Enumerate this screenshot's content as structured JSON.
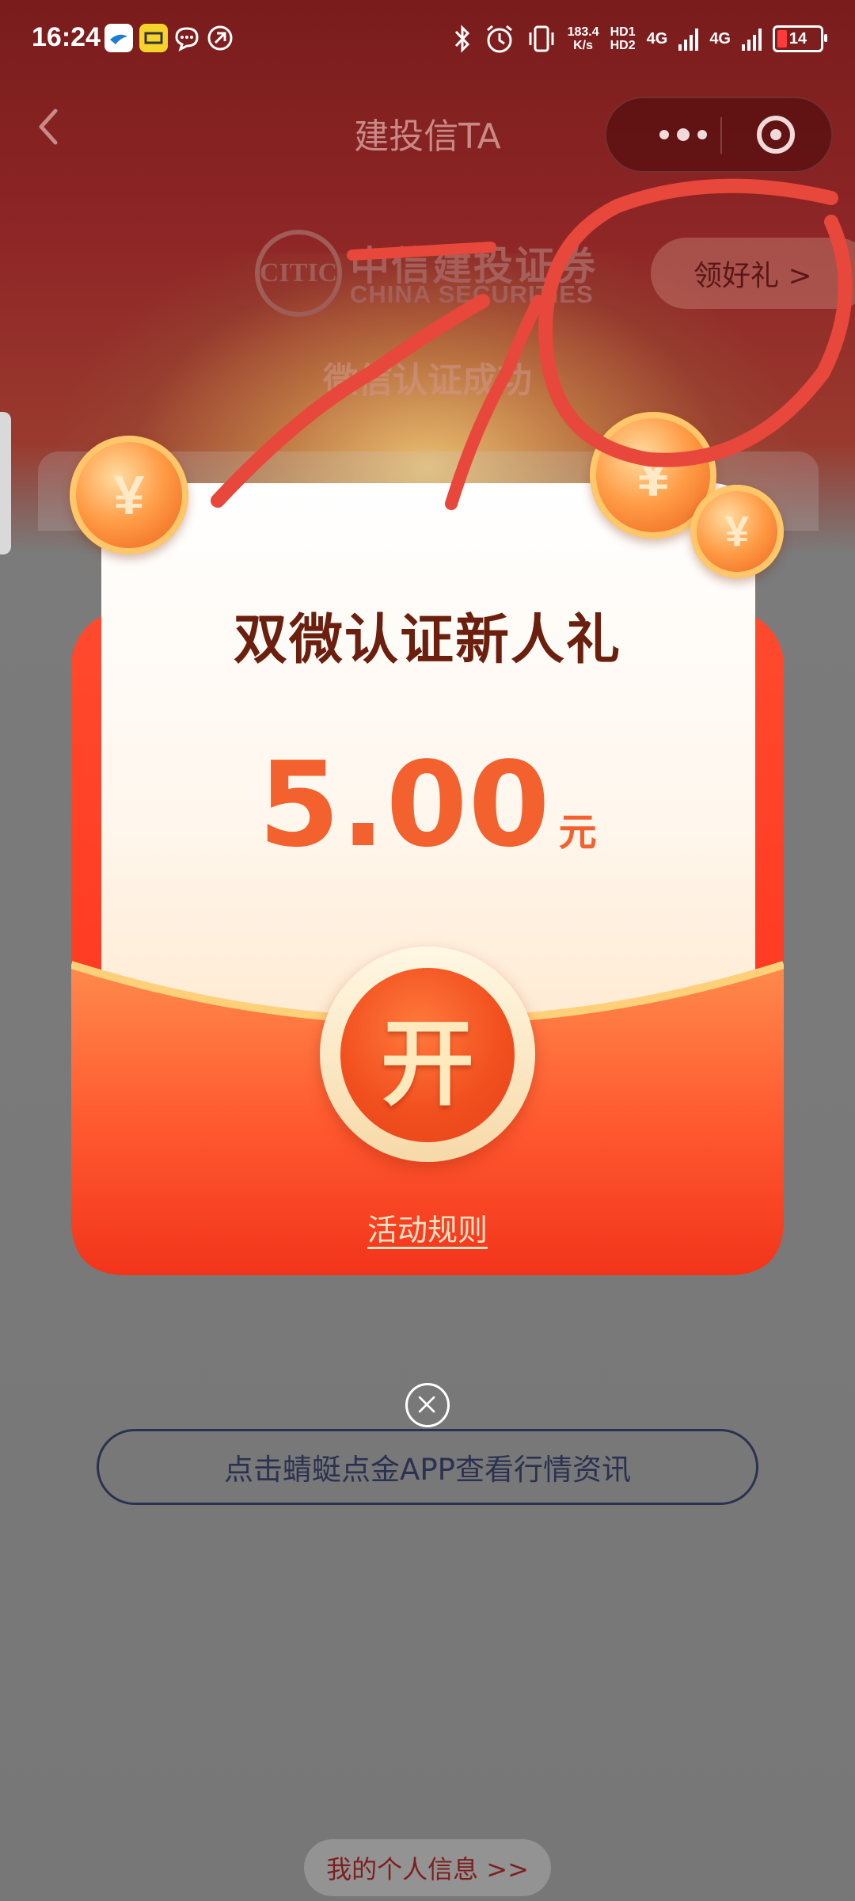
{
  "status_bar": {
    "time": "16:24",
    "net_speed": "183.4",
    "net_speed_unit": "K/s",
    "hd1": "HD1",
    "hd2": "HD2",
    "net1": "4G",
    "net2": "4G",
    "battery": "14",
    "icons": [
      "app-icon",
      "app-icon",
      "chat-bubble-icon",
      "sync-icon",
      "bluetooth-icon",
      "alarm-icon",
      "vibrate-icon",
      "signal-icon",
      "battery-icon"
    ]
  },
  "nav": {
    "title": "建投信TA",
    "back_icon": "chevron-left-icon",
    "more_icon": "more-dots-icon",
    "close_icon": "target-circle-icon"
  },
  "header": {
    "logo_text": "CITIC",
    "brand_cn": "中信建投证券",
    "brand_en": "CHINA SECURITIES",
    "gift_button": "领好礼 >",
    "verify_text": "微信认证成功"
  },
  "red_packet": {
    "title": "双微认证新人礼",
    "amount": "5.00",
    "unit": "元",
    "open_label": "开",
    "rules_link": "活动规则",
    "coin_symbol": "¥"
  },
  "footer": {
    "app_link": "点击蜻蜓点金APP查看行情资讯",
    "info_link": "我的个人信息 >>"
  },
  "colors": {
    "brand_red": "#f2501f",
    "packet_red": "#ff3a22",
    "amount_orange": "#f2612e",
    "scribble_red": "#e8473b"
  }
}
